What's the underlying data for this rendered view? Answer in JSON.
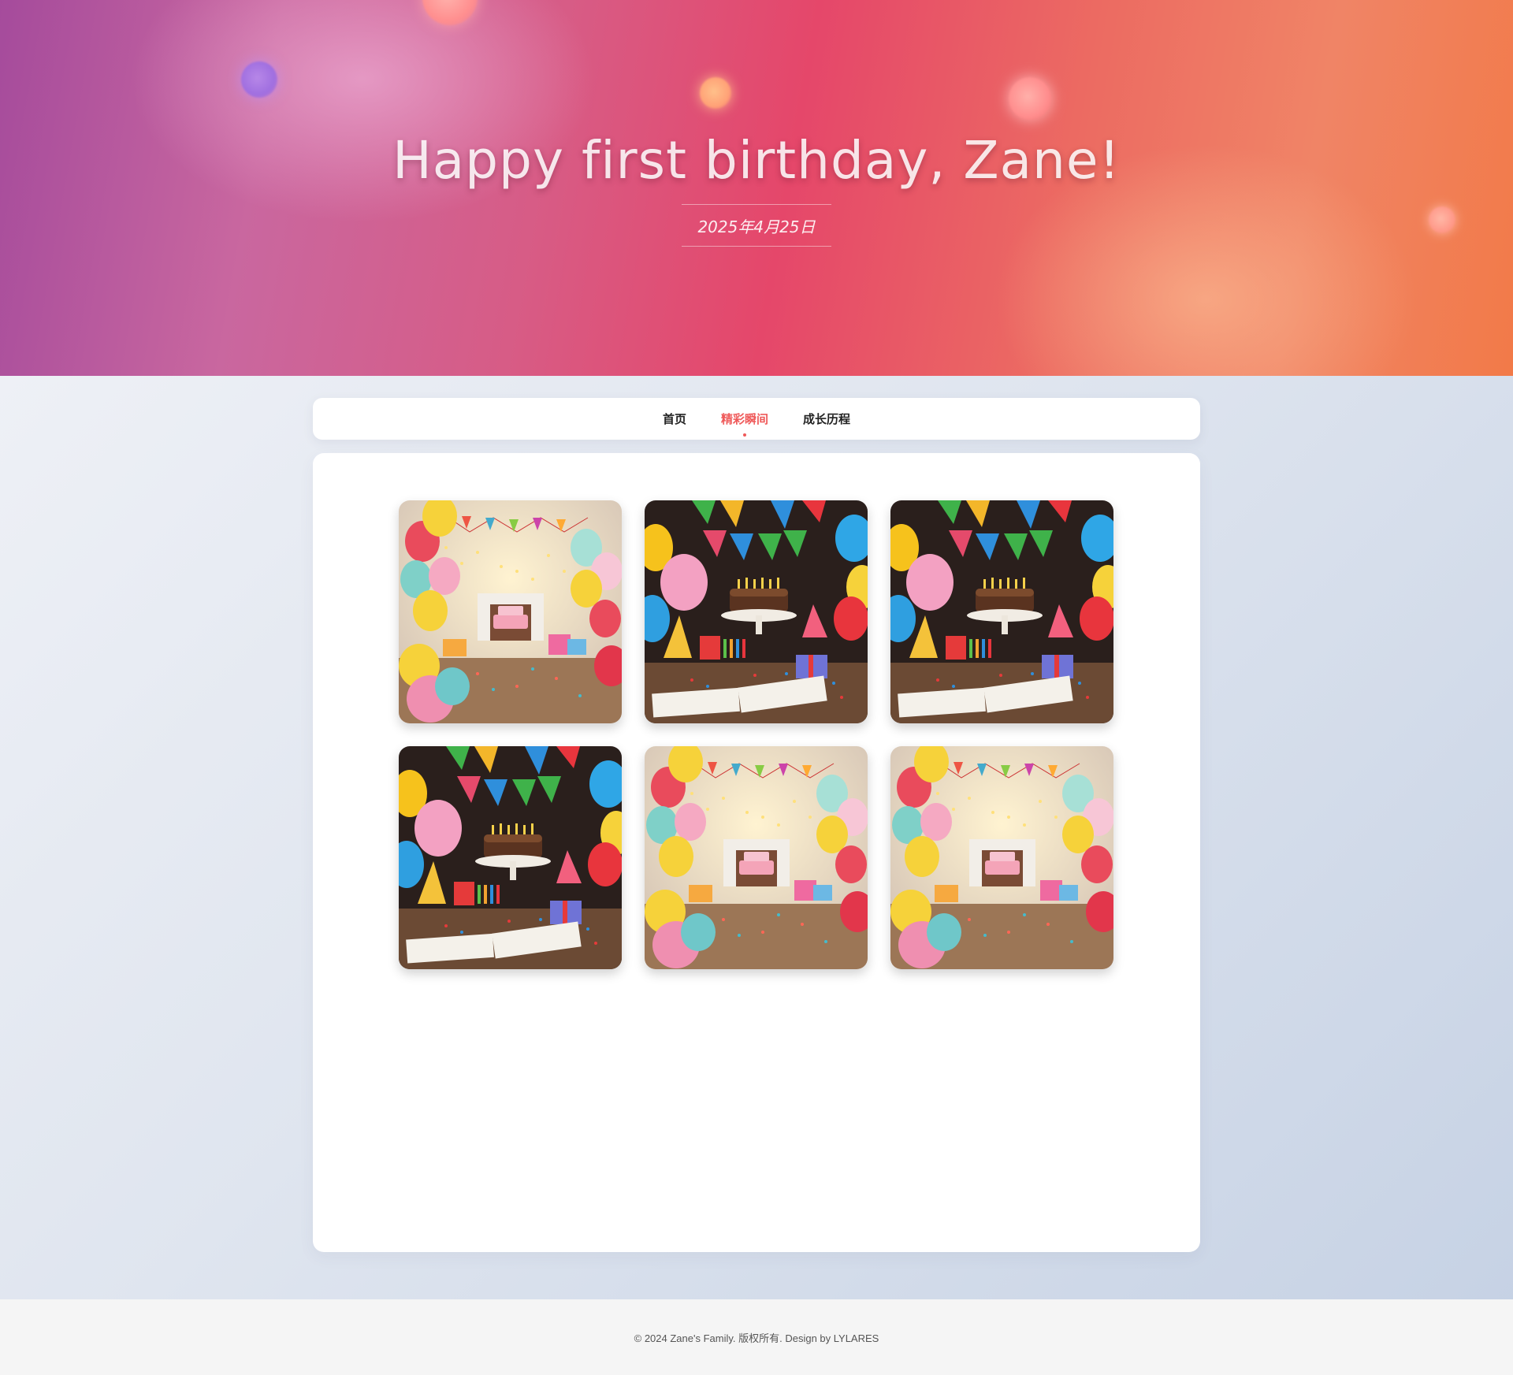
{
  "hero": {
    "title": "Happy first birthday, Zane!",
    "date": "2025年4月25日"
  },
  "nav": {
    "items": [
      {
        "label": "首页",
        "active": false
      },
      {
        "label": "精彩瞬间",
        "active": true
      },
      {
        "label": "成长历程",
        "active": false
      }
    ]
  },
  "gallery": {
    "photos": [
      {
        "scene": "living-room-party-photo"
      },
      {
        "scene": "happy-birthday-banner-cake-photo"
      },
      {
        "scene": "happy-birthday-banner-cake-photo"
      },
      {
        "scene": "happy-birthday-banner-cake-photo"
      },
      {
        "scene": "living-room-party-photo"
      },
      {
        "scene": "living-room-party-photo"
      }
    ]
  },
  "footer": {
    "text": "© 2024 Zane's Family. 版权所有. Design by LYLARES"
  },
  "colors": {
    "accent": "#ef5a5a",
    "hero_start": "#a54b9c",
    "hero_mid": "#e5476a",
    "hero_end": "#f27a48"
  }
}
